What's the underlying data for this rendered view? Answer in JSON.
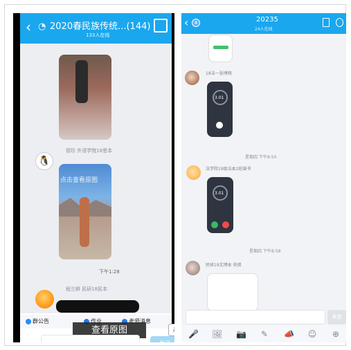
{
  "left": {
    "title": "2020春民族传统...(144)",
    "online": "133人在线",
    "sender1": "德珍 外语学院18思本",
    "overlay": "点击查看原图",
    "time": "下午1:28",
    "sender2": "程兰鲜 民研18民本",
    "toolbar": {
      "notice": "群公告",
      "homework": "作业",
      "teacher": "老师消息"
    },
    "view_original": "查看原图",
    "send": "发送"
  },
  "right": {
    "title": "20235",
    "online": "24人在线",
    "badge": "4",
    "sender1": "18法一张博翔",
    "time1": "星期四 下午8:50",
    "sender2": "法学院19级法本2班曾书",
    "time2": "星期四 下午8:58",
    "sender3": "民研19文博本 央措",
    "gauge1": "3.01",
    "gauge2": "3.01",
    "send": "发送"
  }
}
